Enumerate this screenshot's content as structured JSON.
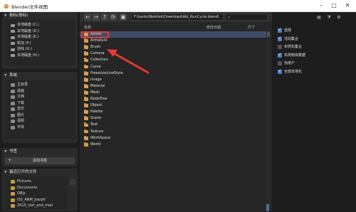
{
  "window": {
    "title": "Blender文件视图",
    "minimize": "–",
    "maximize": "□",
    "close": "✕"
  },
  "sidebar": {
    "volumes_header": "卷标(卷标)",
    "volumes": [
      "本地磁盘 (C:)",
      "本地磁盘 (D:)",
      "本地磁盘 (E:)",
      "新加 (F:)",
      "游戏 (G:)",
      "本地磁盘 (H:)"
    ],
    "system_header": "系统",
    "system": [
      "主目录",
      "桌面",
      "文档",
      "下载",
      "音乐",
      "图片",
      "视频",
      "字体"
    ],
    "bookmarks_header": "书签",
    "add_bookmark": "添加书签",
    "recent_header": "最近打开的文件",
    "recent": [
      "Pictures",
      "Documents",
      "OBJs",
      "ISS_ANM_Josrph",
      "2015_sort_and_man"
    ]
  },
  "toolbar": {
    "back": "←",
    "forward": "→",
    "parent": "↑",
    "refresh": "⟳",
    "new_folder": "▣",
    "path": "F:\\baidu\\Netdisk\\Download\\Abl_RunCycle.blend\\",
    "search_placeholder": ""
  },
  "columns": {
    "name": "名称",
    "date": "修改日期",
    "size": "尺寸"
  },
  "files": [
    "Action",
    "Armature",
    "Brush",
    "Camera",
    "Collection",
    "Curve",
    "FreestyleLineStyle",
    "Image",
    "Material",
    "Mesh",
    "NodeTree",
    "Object",
    "Palette",
    "Scene",
    "Text",
    "Texture",
    "WorkSpace",
    "World"
  ],
  "selected_file": "Action",
  "options": [
    {
      "label": "选择",
      "checked": true
    },
    {
      "label": "活动集合",
      "checked": true
    },
    {
      "label": "实例化集合",
      "checked": false
    },
    {
      "label": "实例物体数据",
      "checked": true
    },
    {
      "label": "伪用户",
      "checked": false
    },
    {
      "label": "全部本地化",
      "checked": true
    }
  ],
  "colors": {
    "accent": "#4d7ec4",
    "folder": "#d2a24e",
    "annotation": "#e53935"
  }
}
